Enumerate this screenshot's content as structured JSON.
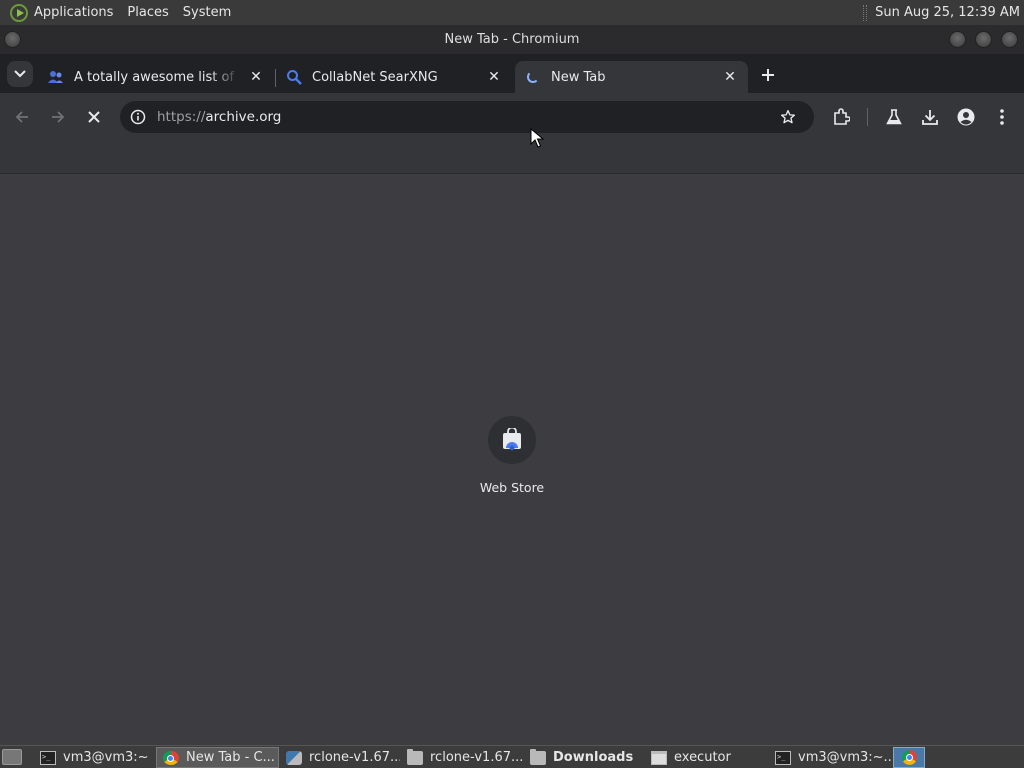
{
  "top_panel": {
    "menus": [
      "Applications",
      "Places",
      "System"
    ],
    "clock": "Sun Aug 25, 12:39 AM"
  },
  "window": {
    "title": "New Tab - Chromium"
  },
  "tabs": [
    {
      "title": "A totally awesome list of \"old",
      "icon": "people-icon",
      "active": false
    },
    {
      "title": "CollabNet SearXNG",
      "icon": "search-icon",
      "active": false
    },
    {
      "title": "New Tab",
      "icon": "loading-spinner-icon",
      "active": true
    }
  ],
  "omnibox": {
    "scheme": "https://",
    "host": "archive.org"
  },
  "new_tab_page": {
    "shortcuts": [
      {
        "label": "Web Store",
        "icon": "web-store-icon"
      }
    ]
  },
  "taskbar": {
    "items": [
      {
        "label": "vm3@vm3:~",
        "icon": "terminal-icon",
        "active": false,
        "bold": false
      },
      {
        "label": "New Tab - C...",
        "icon": "chromium-icon",
        "active": true,
        "bold": false
      },
      {
        "label": "rclone-v1.67...",
        "icon": "rclone-icon",
        "active": false,
        "bold": false
      },
      {
        "label": "rclone-v1.67...",
        "icon": "folder-icon",
        "active": false,
        "bold": false
      },
      {
        "label": "Downloads",
        "icon": "folder-icon",
        "active": false,
        "bold": true
      },
      {
        "label": "executor",
        "icon": "window-icon",
        "active": false,
        "bold": false
      },
      {
        "label": "vm3@vm3:~...",
        "icon": "terminal-icon",
        "active": false,
        "bold": false
      }
    ]
  },
  "colors": {
    "tab_strip": "#202124",
    "toolbar": "#35363a",
    "content_bg": "#3c3c41",
    "accent_blue": "#8ab4f8"
  }
}
